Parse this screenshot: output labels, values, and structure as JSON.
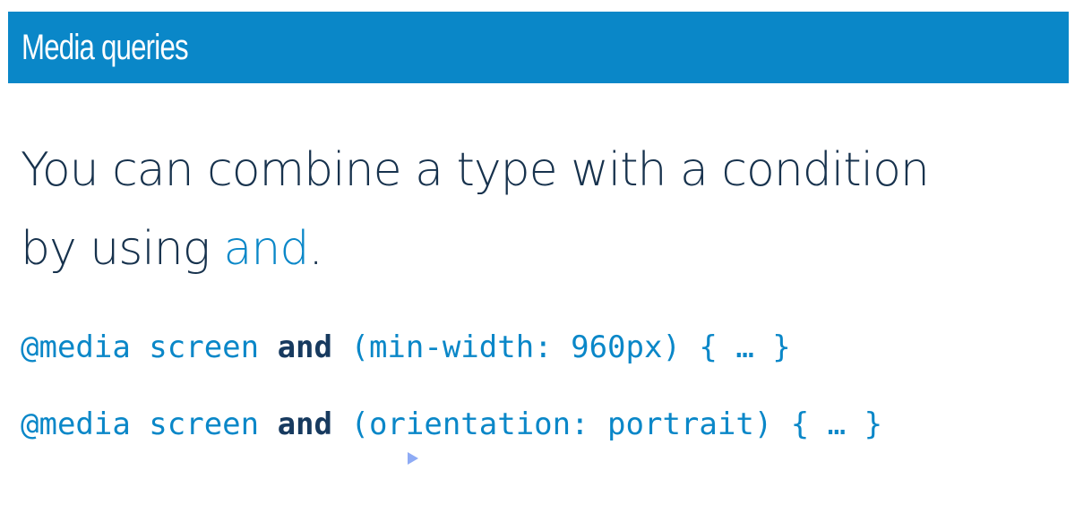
{
  "slide": {
    "title": "Media queries",
    "body": {
      "line_1_prefix": "You can combine a type with a condition",
      "line_2_prefix": "by using ",
      "keyword": "and",
      "punctuation": "."
    },
    "code": [
      {
        "before_keyword": "@media screen ",
        "keyword": "and",
        "after_keyword": " (min-width: 960px) { … }"
      },
      {
        "before_keyword": "@media screen ",
        "keyword": "and",
        "after_keyword": " (orientation: portrait) { … }"
      }
    ],
    "icons": {
      "cursor": "cursor-icon"
    },
    "colors": {
      "accent": "#0a87c8",
      "text": "#17324d",
      "keyword": "#173a5f"
    }
  }
}
